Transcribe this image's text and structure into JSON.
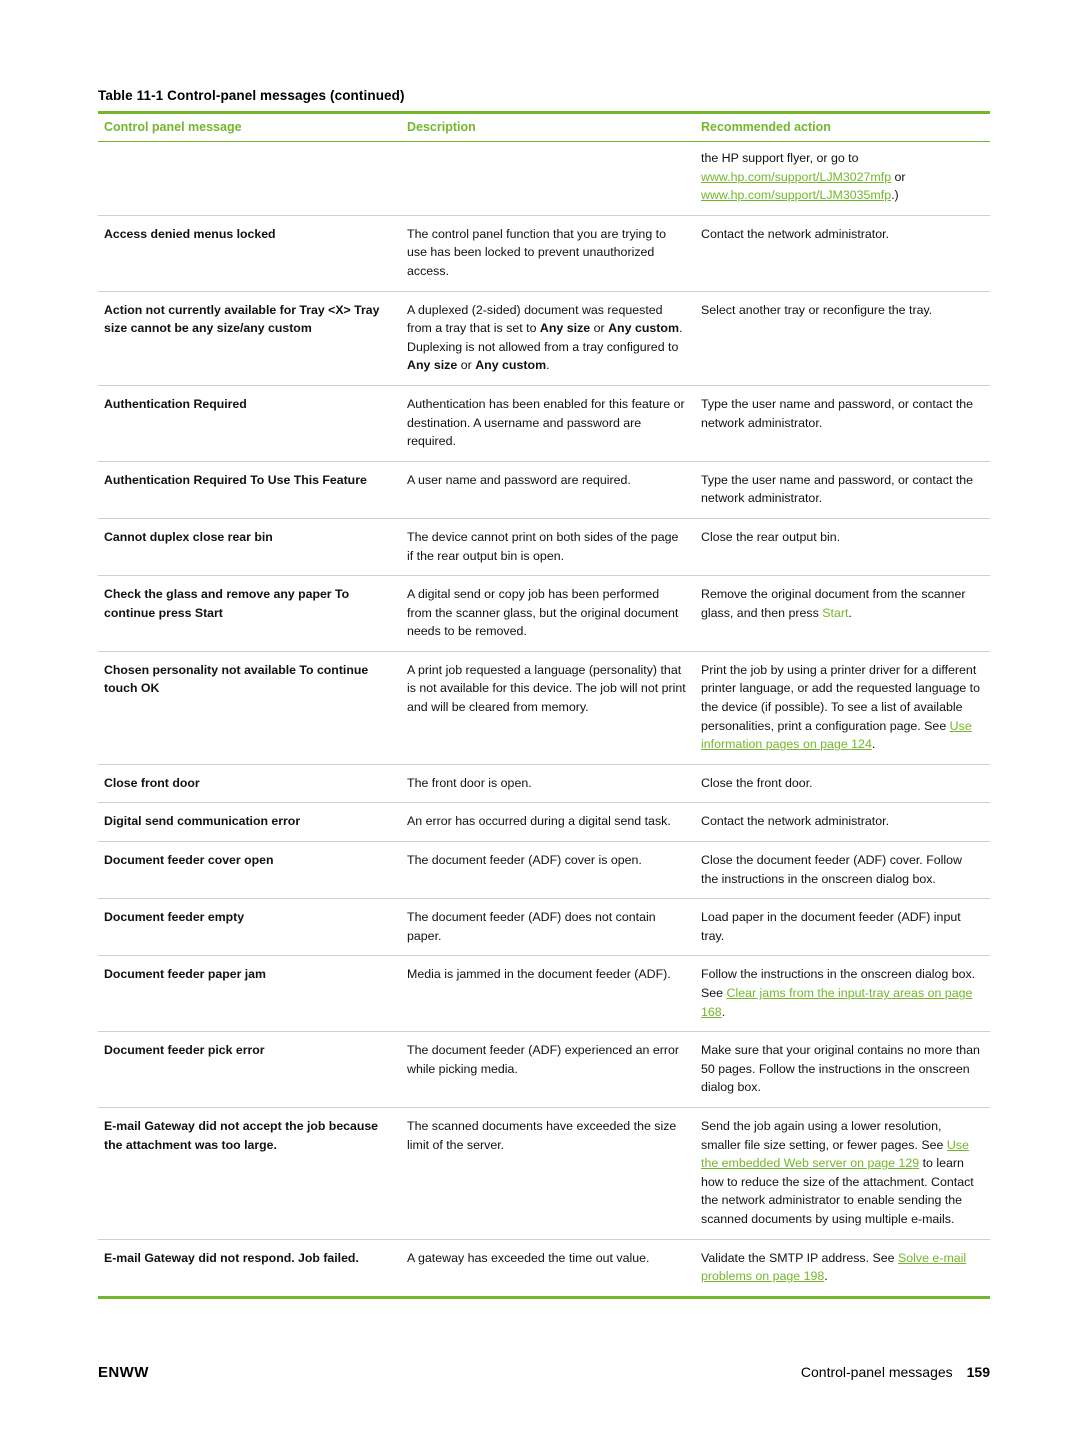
{
  "caption": {
    "number": "Table 11-1",
    "text": "Control-panel messages (continued)"
  },
  "table": {
    "headers": [
      "Control panel message",
      "Description",
      "Recommended action"
    ],
    "rows": [
      {
        "message": "",
        "description": "",
        "action_parts": [
          {
            "t": "the HP support flyer, or go to ",
            "s": "plain"
          },
          {
            "t": "www.hp.com/",
            "s": "link"
          },
          {
            "t": "support/LJM3027mfp",
            "s": "link"
          },
          {
            "t": " or ",
            "s": "plain"
          },
          {
            "t": "www.hp.com/",
            "s": "link"
          },
          {
            "t": "support/LJM3035mfp",
            "s": "link"
          },
          {
            "t": ".)",
            "s": "plain"
          }
        ]
      },
      {
        "message": "Access denied menus locked",
        "description": "The control panel function that you are trying to use has been locked to prevent unauthorized access.",
        "action_parts": [
          {
            "t": "Contact the network administrator.",
            "s": "plain"
          }
        ]
      },
      {
        "message": "Action not currently available for Tray <X> Tray size cannot be any size/any custom",
        "description_parts": [
          {
            "t": "A duplexed (2-sided) document was requested from a tray that is set to ",
            "s": "plain"
          },
          {
            "t": "Any size",
            "s": "bold"
          },
          {
            "t": " or ",
            "s": "plain"
          },
          {
            "t": "Any custom",
            "s": "bold"
          },
          {
            "t": ". Duplexing is not allowed from a tray configured to ",
            "s": "plain"
          },
          {
            "t": "Any size",
            "s": "bold"
          },
          {
            "t": " or ",
            "s": "plain"
          },
          {
            "t": "Any custom",
            "s": "bold"
          },
          {
            "t": ".",
            "s": "plain"
          }
        ],
        "action_parts": [
          {
            "t": "Select another tray or reconfigure the tray.",
            "s": "plain"
          }
        ]
      },
      {
        "message": "Authentication Required",
        "description": "Authentication has been enabled for this feature or destination. A username and password are required.",
        "action_parts": [
          {
            "t": "Type the user name and password, or contact the network administrator.",
            "s": "plain"
          }
        ]
      },
      {
        "message": "Authentication Required To Use This Feature",
        "description": "A user name and password are required.",
        "action_parts": [
          {
            "t": "Type the user name and password, or contact the network administrator.",
            "s": "plain"
          }
        ]
      },
      {
        "message": "Cannot duplex close rear bin",
        "description": "The device cannot print on both sides of the page if the rear output bin is open.",
        "action_parts": [
          {
            "t": "Close the rear output bin.",
            "s": "plain"
          }
        ]
      },
      {
        "message": "Check the glass and remove any paper To continue press Start",
        "description": "A digital send or copy job has been performed from the scanner glass, but the original document needs to be removed.",
        "action_parts": [
          {
            "t": "Remove the original document from the scanner glass, and then press ",
            "s": "plain"
          },
          {
            "t": "Start",
            "s": "green"
          },
          {
            "t": ".",
            "s": "plain"
          }
        ]
      },
      {
        "message": "Chosen personality not available To continue touch OK",
        "description": "A print job requested a language (personality) that is not available for this device. The job will not print and will be cleared from memory.",
        "action_parts": [
          {
            "t": "Print the job by using a printer driver for a different printer language, or add the requested language to the device (if possible). To see a list of available personalities, print a configuration page. See ",
            "s": "plain"
          },
          {
            "t": "Use information pages on page  124",
            "s": "link"
          },
          {
            "t": ".",
            "s": "plain"
          }
        ]
      },
      {
        "message": "Close front door",
        "description": "The front door is open.",
        "action_parts": [
          {
            "t": "Close the front door.",
            "s": "plain"
          }
        ]
      },
      {
        "message": "Digital send communication error",
        "description": "An error has occurred during a digital send task.",
        "action_parts": [
          {
            "t": "Contact the network administrator.",
            "s": "plain"
          }
        ]
      },
      {
        "message": "Document feeder cover open",
        "description": "The document feeder (ADF) cover is open.",
        "action_parts": [
          {
            "t": "Close the document feeder (ADF) cover. Follow the instructions in the onscreen dialog box.",
            "s": "plain"
          }
        ]
      },
      {
        "message": "Document feeder empty",
        "description": "The document feeder (ADF) does not contain paper.",
        "action_parts": [
          {
            "t": "Load paper in the document feeder (ADF) input tray.",
            "s": "plain"
          }
        ]
      },
      {
        "message": "Document feeder paper jam",
        "description": "Media is jammed in the document feeder (ADF).",
        "action_parts": [
          {
            "t": "Follow the instructions in the onscreen dialog box. See ",
            "s": "plain"
          },
          {
            "t": "Clear jams from the input-tray areas on page  168",
            "s": "link"
          },
          {
            "t": ".",
            "s": "plain"
          }
        ]
      },
      {
        "message": "Document feeder pick error",
        "description": "The document feeder (ADF) experienced an error while picking media.",
        "action_parts": [
          {
            "t": "Make sure that your original contains no more than 50 pages. Follow the instructions in the onscreen dialog box.",
            "s": "plain"
          }
        ]
      },
      {
        "message": "E-mail Gateway did not accept the job because the attachment was too large.",
        "description": "The scanned documents have exceeded the size limit of the server.",
        "action_parts": [
          {
            "t": "Send the job again using a lower resolution, smaller file size setting, or fewer pages. See ",
            "s": "plain"
          },
          {
            "t": "Use the embedded Web server on page  129",
            "s": "link"
          },
          {
            "t": " to learn how to reduce the size of the attachment. Contact the network administrator to enable sending the scanned documents by using multiple e-mails.",
            "s": "plain"
          }
        ]
      },
      {
        "message": "E-mail Gateway did not respond. Job failed.",
        "description": "A gateway has exceeded the time out value.",
        "action_parts": [
          {
            "t": "Validate the SMTP IP address. See ",
            "s": "plain"
          },
          {
            "t": "Solve e-mail problems on page  198",
            "s": "link"
          },
          {
            "t": ".",
            "s": "plain"
          }
        ]
      }
    ]
  },
  "footer": {
    "left": "ENWW",
    "right": "Control-panel messages",
    "page": "159"
  }
}
